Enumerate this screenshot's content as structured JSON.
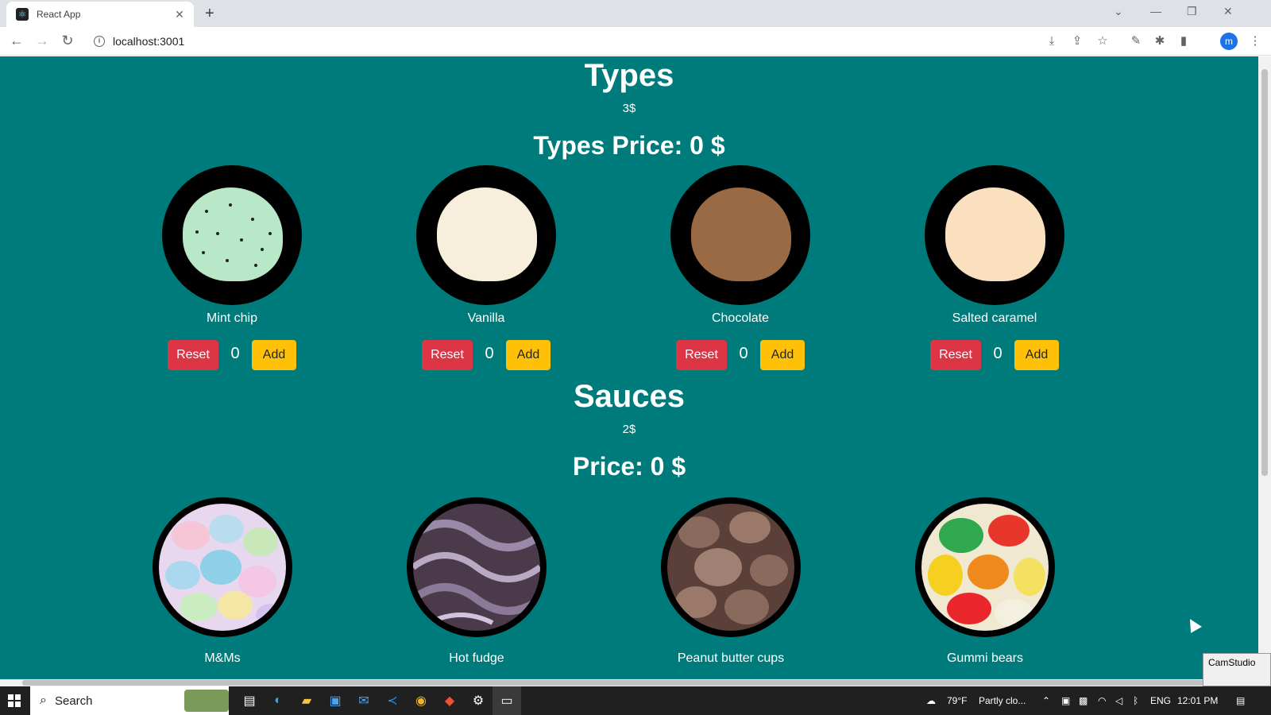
{
  "browser": {
    "tab_title": "React App",
    "tab_close": "✕",
    "new_tab": "+",
    "url": "localhost:3001",
    "profile_initial": "m",
    "window_controls": {
      "minimize": "—",
      "restore": "❐",
      "close": "✕",
      "tabsearch": "⌄"
    },
    "nav": {
      "back": "←",
      "forward": "→",
      "reload": "↻"
    },
    "toolbar_icons": {
      "install": "⤓",
      "share": "⇪",
      "bookmark": "☆",
      "extension_a": "✎",
      "extensions": "✱",
      "sidepanel": "▮",
      "menu": "⋮"
    }
  },
  "page": {
    "types": {
      "title": "Types",
      "unit_price": "3$",
      "price_label": "Types Price: 0 $",
      "items": [
        {
          "name": "Mint chip",
          "count": "0",
          "reset": "Reset",
          "add": "Add",
          "color": "#b9e8c8"
        },
        {
          "name": "Vanilla",
          "count": "0",
          "reset": "Reset",
          "add": "Add",
          "color": "#f7efdc"
        },
        {
          "name": "Chocolate",
          "count": "0",
          "reset": "Reset",
          "add": "Add",
          "color": "#9a6a45"
        },
        {
          "name": "Salted caramel",
          "count": "0",
          "reset": "Reset",
          "add": "Add",
          "color": "#fbe0c0"
        }
      ]
    },
    "sauces": {
      "title": "Sauces",
      "unit_price": "2$",
      "price_label": "Price: 0 $",
      "items": [
        {
          "name": "M&Ms"
        },
        {
          "name": "Hot fudge"
        },
        {
          "name": "Peanut butter cups"
        },
        {
          "name": "Gummi bears"
        }
      ]
    }
  },
  "taskbar": {
    "search_label": "Search",
    "weather": "79°F",
    "weather_desc": "Partly clo...",
    "language": "ENG",
    "time": "12:01 PM",
    "camstudio": "CamStudio"
  }
}
